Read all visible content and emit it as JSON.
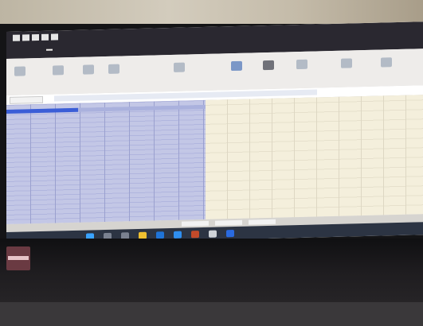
{
  "scene": {
    "type": "photo-of-laptop-screen",
    "app": "spreadsheet",
    "note_text": ""
  },
  "colors": {
    "selection_fill": "#c3c7e6",
    "header_highlight": "#3b5ed7",
    "sheet_background": "#f4efdc",
    "taskbar": "#2c3443"
  },
  "icons": [
    "windows-start-icon",
    "taskbar-app-icon"
  ]
}
